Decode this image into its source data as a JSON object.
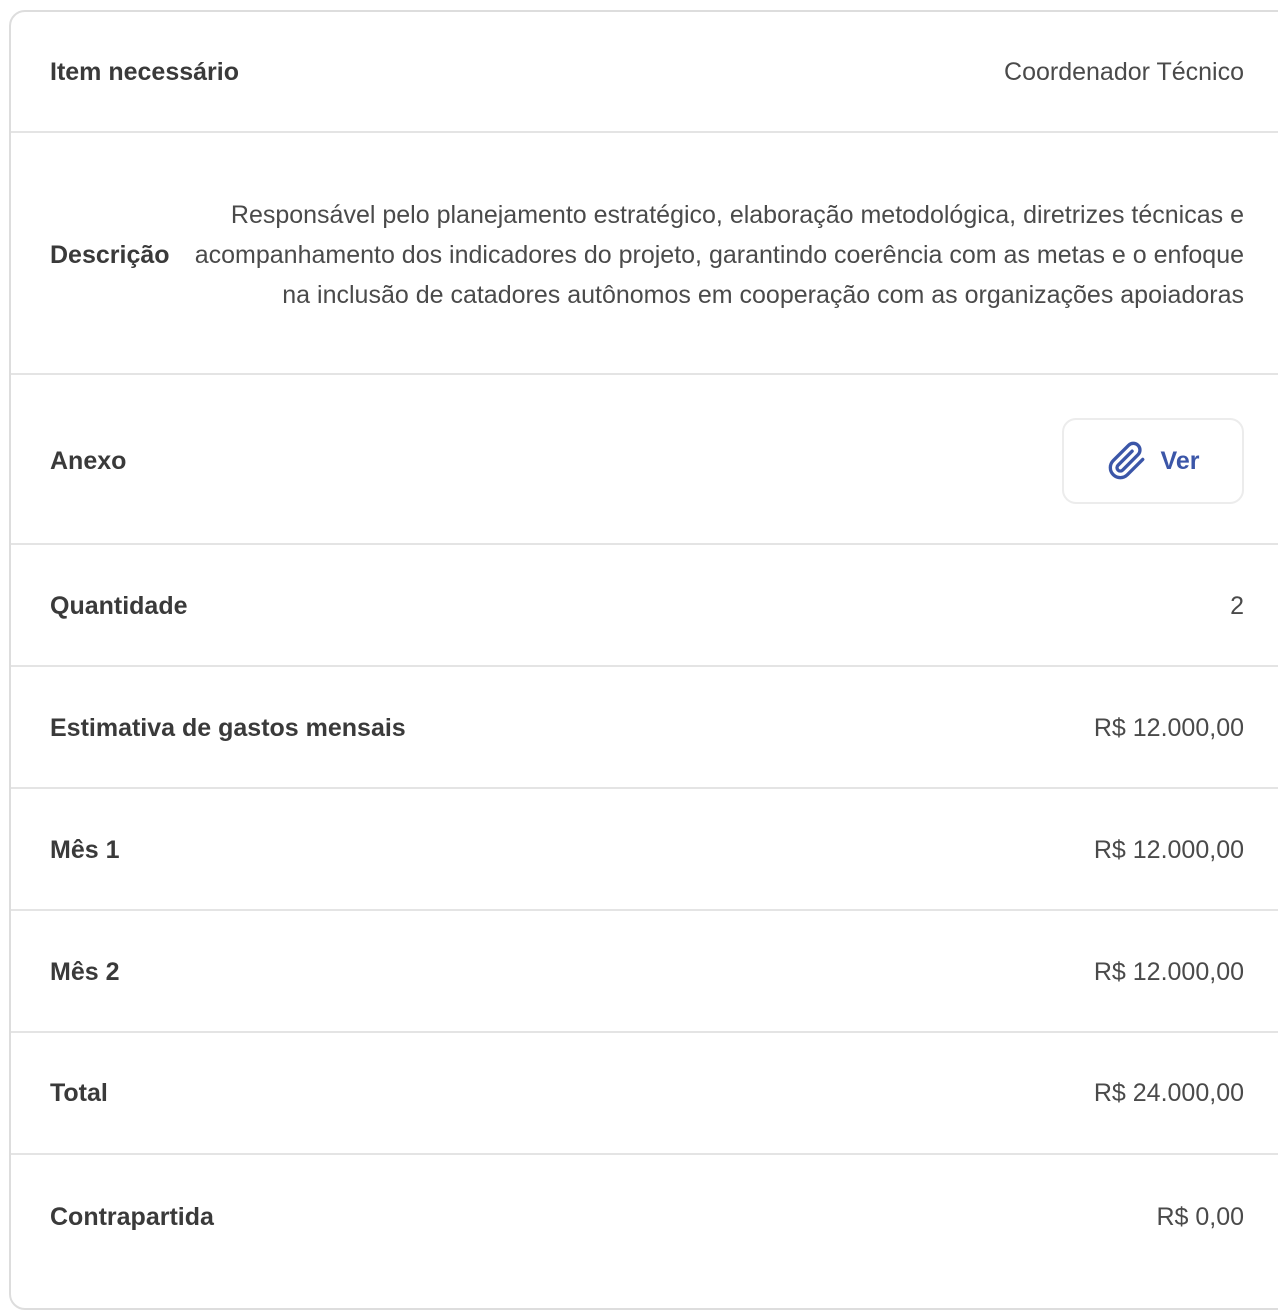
{
  "rows": {
    "item": {
      "label": "Item necessário",
      "value": "Coordenador Técnico"
    },
    "descricao": {
      "label": "Descrição",
      "value": "Responsável pelo planejamento estratégico, elaboração metodológica, diretrizes técnicas e acompanhamento dos indicadores do projeto, garantindo coerência com as metas e o enfoque na inclusão de catadores autônomos em cooperação com as organizações apoiadoras"
    },
    "anexo": {
      "label": "Anexo",
      "button_label": "Ver",
      "icon": "paperclip-icon"
    },
    "quantidade": {
      "label": "Quantidade",
      "value": "2"
    },
    "estimativa": {
      "label": "Estimativa de gastos mensais",
      "value": "R$ 12.000,00"
    },
    "mes1": {
      "label": "Mês 1",
      "value": "R$ 12.000,00"
    },
    "mes2": {
      "label": "Mês 2",
      "value": "R$ 12.000,00"
    },
    "total": {
      "label": "Total",
      "value": "R$ 24.000,00"
    },
    "contrapartida": {
      "label": "Contrapartida",
      "value": "R$ 0,00"
    }
  },
  "colors": {
    "accent": "#3b56a8",
    "border": "#dddddd",
    "divider": "#e4e4e4"
  }
}
